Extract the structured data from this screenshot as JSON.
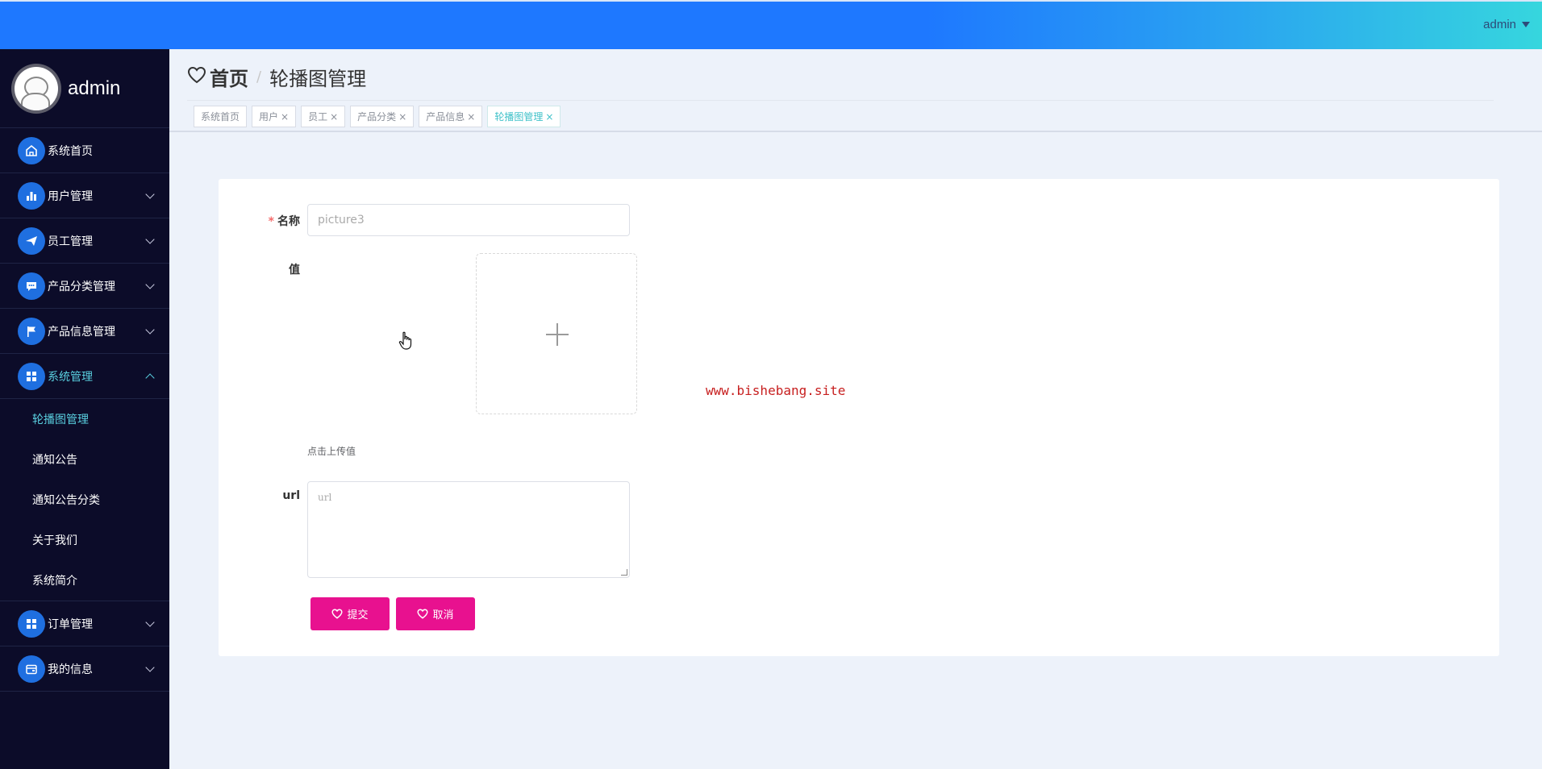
{
  "header": {
    "user_label": "admin"
  },
  "sidebar": {
    "profile_name": "admin",
    "items": [
      {
        "label": "系统首页",
        "icon": "home-icon"
      },
      {
        "label": "用户管理",
        "icon": "bar-chart-icon"
      },
      {
        "label": "员工管理",
        "icon": "paper-plane-icon"
      },
      {
        "label": "产品分类管理",
        "icon": "chat-bubble-icon"
      },
      {
        "label": "产品信息管理",
        "icon": "flag-icon"
      },
      {
        "label": "系统管理",
        "icon": "grid-icon"
      },
      {
        "label": "订单管理",
        "icon": "grid-icon"
      },
      {
        "label": "我的信息",
        "icon": "wallet-icon"
      }
    ],
    "system_subitems": [
      "轮播图管理",
      "通知公告",
      "通知公告分类",
      "关于我们",
      "系统简介"
    ]
  },
  "breadcrumb": {
    "home": "首页",
    "separator": "/",
    "current": "轮播图管理"
  },
  "tabs": [
    {
      "label": "系统首页",
      "closable": false
    },
    {
      "label": "用户",
      "closable": true
    },
    {
      "label": "员工",
      "closable": true
    },
    {
      "label": "产品分类",
      "closable": true
    },
    {
      "label": "产品信息",
      "closable": true
    },
    {
      "label": "轮播图管理",
      "closable": true
    }
  ],
  "close_glyph": "×",
  "form": {
    "required_mark": "*",
    "name_label": "名称",
    "name_placeholder": "picture3",
    "value_label": "值",
    "upload_hint": "点击上传值",
    "url_label": "url",
    "url_placeholder": "url",
    "submit_label": "提交",
    "cancel_label": "取消"
  },
  "watermark": "www.bishebang.site",
  "colors": {
    "accent_active": "#5ad0e0",
    "button": "#e8118f",
    "sidebar_bg": "#0c0c29",
    "topbar": "#1e78ff"
  }
}
